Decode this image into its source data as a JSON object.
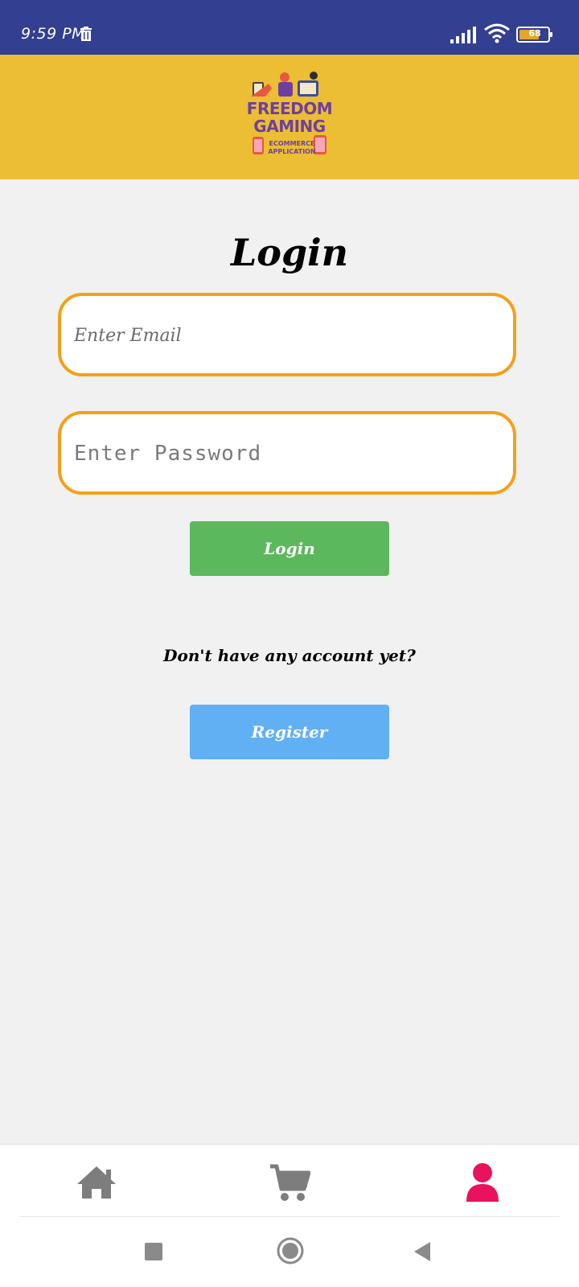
{
  "status_bar": {
    "time": "9:59 PM",
    "battery": "68"
  },
  "header": {
    "logo_title": "FREEDOM GAMING",
    "logo_subtitle": "ECOMMERCE APPLICATION"
  },
  "login": {
    "title": "Login",
    "email_placeholder": "Enter Email",
    "password_placeholder": "Enter Password",
    "login_button": "Login",
    "register_prompt": "Don't have any account yet?",
    "register_button": "Register"
  },
  "bottom_nav": {
    "items": [
      {
        "icon": "home-icon",
        "active": false
      },
      {
        "icon": "cart-icon",
        "active": false
      },
      {
        "icon": "profile-icon",
        "active": true
      }
    ],
    "active_color": "#e8125f",
    "inactive_color": "#7d7d7d"
  },
  "colors": {
    "status_bar": "#333f91",
    "header": "#ebbe34",
    "input_border": "#f2a11c",
    "login_button": "#5cb85c",
    "register_button": "#62b0f4"
  }
}
